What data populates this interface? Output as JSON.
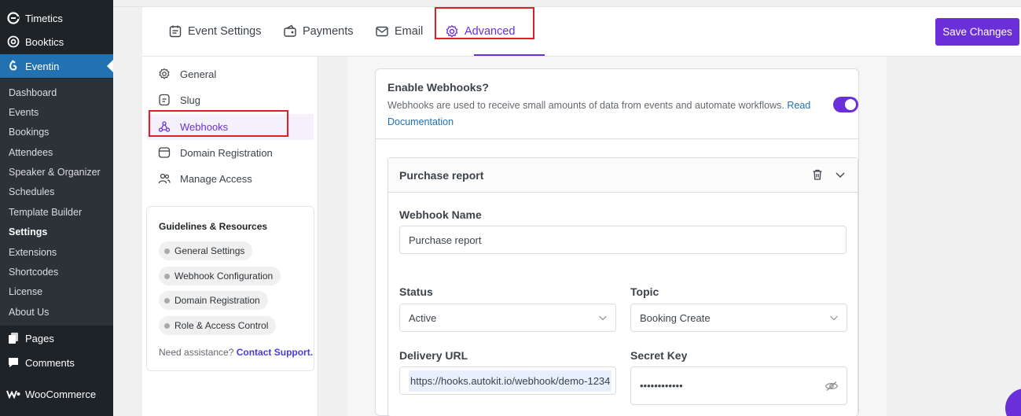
{
  "wp_menu": {
    "top": [
      {
        "label": "Timetics",
        "icon": "timetics-icon"
      },
      {
        "label": "Booktics",
        "icon": "booktics-icon"
      },
      {
        "label": "Eventin",
        "icon": "eventin-icon"
      }
    ],
    "submenu": [
      "Dashboard",
      "Events",
      "Bookings",
      "Attendees",
      "Speaker & Organizer",
      "Schedules",
      "Template Builder",
      "Settings",
      "Extensions",
      "Shortcodes",
      "License",
      "About Us"
    ],
    "bottom": [
      {
        "label": "Pages",
        "icon": "pages-icon"
      },
      {
        "label": "Comments",
        "icon": "comments-icon"
      },
      {
        "label": "WooCommerce",
        "icon": "woocommerce-icon"
      }
    ]
  },
  "tabs": [
    {
      "label": "Event Settings",
      "icon": "event-settings-icon"
    },
    {
      "label": "Payments",
      "icon": "payments-icon"
    },
    {
      "label": "Email",
      "icon": "email-icon"
    },
    {
      "label": "Advanced",
      "icon": "gear-icon"
    }
  ],
  "save_label": "Save Changes",
  "left_nav": [
    {
      "label": "General",
      "icon": "gear-icon"
    },
    {
      "label": "Slug",
      "icon": "slug-icon"
    },
    {
      "label": "Webhooks",
      "icon": "webhook-icon"
    },
    {
      "label": "Domain Registration",
      "icon": "domain-icon"
    },
    {
      "label": "Manage Access",
      "icon": "users-icon"
    }
  ],
  "guidelines": {
    "title": "Guidelines & Resources",
    "items": [
      "General Settings",
      "Webhook Configuration",
      "Domain Registration",
      "Role & Access Control"
    ],
    "help_text": "Need assistance?",
    "help_link": "Contact Support."
  },
  "webhooks": {
    "enable_title": "Enable Webhooks?",
    "enable_desc": "Webhooks are used to receive small amounts of data from events and automate workflows.",
    "read_link": "Read Documentation",
    "enabled": true,
    "card_title": "Purchase report",
    "name_label": "Webhook Name",
    "name_value": "Purchase report",
    "status_label": "Status",
    "status_value": "Active",
    "topic_label": "Topic",
    "topic_value": "Booking Create",
    "url_label": "Delivery URL",
    "url_value": "https://hooks.autokit.io/webhook/demo-1234",
    "secret_label": "Secret Key",
    "secret_value": "••••••••••••"
  },
  "colors": {
    "accent": "#6b2fd9",
    "wp_sidebar": "#1d2327",
    "wp_active": "#2271b1",
    "highlight": "#e11d2a"
  }
}
